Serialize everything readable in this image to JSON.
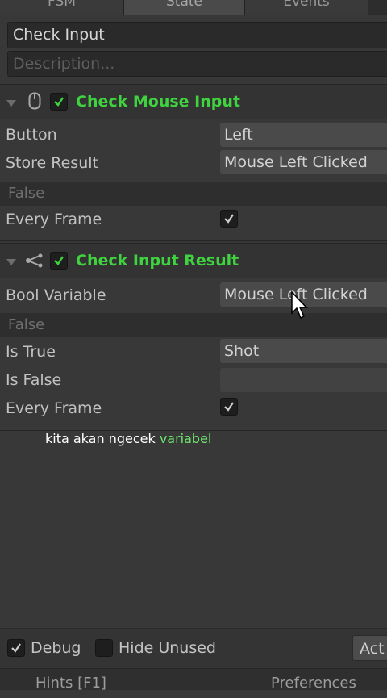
{
  "tabs": [
    "FSM",
    "State",
    "Events"
  ],
  "state": {
    "name": "Check Input",
    "description_placeholder": "Description..."
  },
  "actions": [
    {
      "title": "Check Mouse Input",
      "icon": "mouse-icon",
      "fields": {
        "button_label": "Button",
        "button_value": "Left",
        "store_result_label": "Store Result",
        "store_result_value": "Mouse Left Clicked",
        "false_text": "False",
        "every_frame_label": "Every Frame"
      }
    },
    {
      "title": "Check Input Result",
      "icon": "branch-icon",
      "fields": {
        "bool_variable_label": "Bool Variable",
        "bool_variable_value": "Mouse Left Clicked",
        "false_text": "False",
        "is_true_label": "Is True",
        "is_true_value": "Shot",
        "is_false_label": "Is False",
        "is_false_value": "",
        "every_frame_label": "Every Frame"
      }
    }
  ],
  "caption": {
    "text": "kita akan ngecek ",
    "highlight": "variabel"
  },
  "bottom": {
    "debug_label": "Debug",
    "hide_unused_label": "Hide Unused",
    "action_label": "Act"
  },
  "footer": {
    "hints_label": "Hints [F1]",
    "preferences_label": "Preferences"
  },
  "colors": {
    "accent": "#3fd33f",
    "panel": "#383838"
  }
}
